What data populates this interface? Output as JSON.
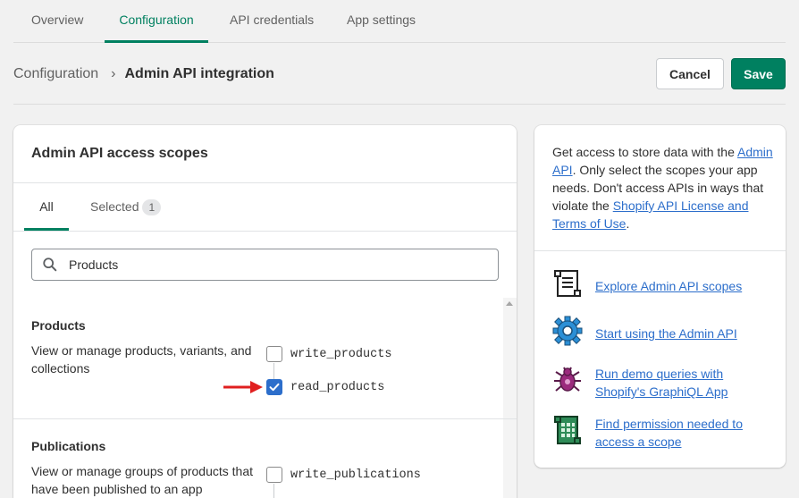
{
  "tabs": [
    {
      "label": "Overview"
    },
    {
      "label": "Configuration"
    },
    {
      "label": "API credentials"
    },
    {
      "label": "App settings"
    }
  ],
  "breadcrumb": {
    "parent": "Configuration",
    "current": "Admin API integration"
  },
  "actions": {
    "cancel": "Cancel",
    "save": "Save"
  },
  "scopes_card": {
    "title": "Admin API access scopes",
    "tab_all": "All",
    "tab_selected": "Selected",
    "selected_count": "1",
    "search_value": "Products",
    "sections": [
      {
        "title": "Products",
        "description": "View or manage products, variants, and collections",
        "scopes": [
          {
            "name": "write_products",
            "checked": false
          },
          {
            "name": "read_products",
            "checked": true
          }
        ]
      },
      {
        "title": "Publications",
        "description": "View or manage groups of products that have been published to an app",
        "scopes": [
          {
            "name": "write_publications",
            "checked": false
          }
        ]
      }
    ]
  },
  "info_card": {
    "text_1": "Get access to store data with the",
    "link_admin_api": "Admin API",
    "text_2": ". Only select the scopes your app needs. Don't access APIs in ways that violate the",
    "link_license": "Shopify API License and Terms of Use",
    "text_3": ".",
    "resources": [
      {
        "icon": "scroll-icon",
        "label": "Explore Admin API scopes"
      },
      {
        "icon": "gear-icon",
        "label": "Start using the Admin API"
      },
      {
        "icon": "bug-icon",
        "label": "Run demo queries with Shopify's GraphiQL App"
      },
      {
        "icon": "calculator-icon",
        "label": "Find permission needed to access a scope"
      }
    ]
  },
  "colors": {
    "accent": "#008060",
    "link": "#2c6ecb",
    "checkbox": "#2c6ecb",
    "annotation_arrow": "#e02020"
  }
}
